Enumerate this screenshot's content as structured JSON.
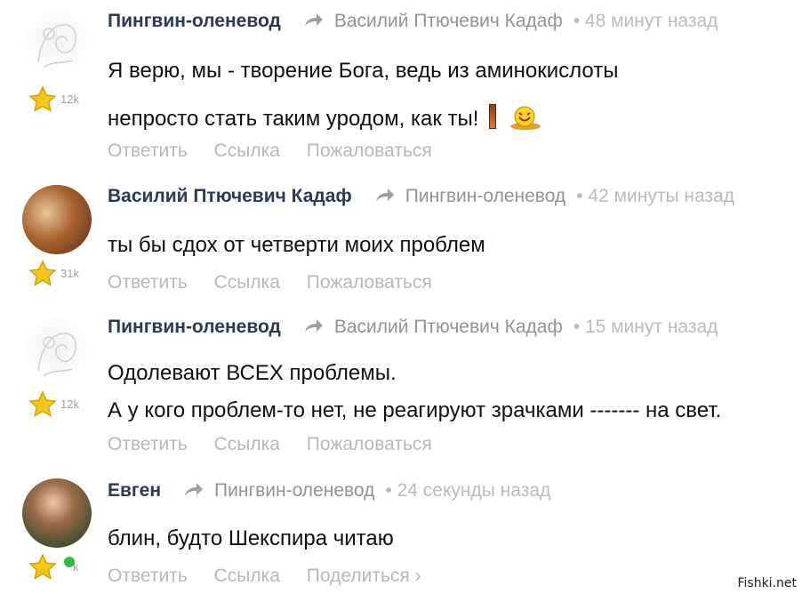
{
  "comments": [
    {
      "author": "Пингвин-оленевод",
      "reply_to": "Василий Птючевич Кадаф",
      "time": "• 48 минут назад",
      "rating": "12k",
      "lines": [
        "Я верю, мы - творение Бога, ведь из аминокислоты",
        "непросто стать таким уродом, как ты!"
      ],
      "actions": [
        "Ответить",
        "Ссылка",
        "Пожаловаться"
      ]
    },
    {
      "author": "Василий Птючевич Кадаф",
      "reply_to": "Пингвин-оленевод",
      "time": "• 42 минуты назад",
      "rating": "31k",
      "lines": [
        "ты бы сдох от четверти моих проблем"
      ],
      "actions": [
        "Ответить",
        "Ссылка",
        "Пожаловаться"
      ]
    },
    {
      "author": "Пингвин-оленевод",
      "reply_to": "Василий Птючевич Кадаф",
      "time": "• 15 минут назад",
      "rating": "12k",
      "lines": [
        "Одолевают ВСЕХ проблемы.",
        "А у кого проблем-то нет, не реагируют зрачками ------- на свет."
      ],
      "actions": [
        "Ответить",
        "Ссылка",
        "Пожаловаться"
      ]
    },
    {
      "author": "Евген",
      "reply_to": "Пингвин-оленевод",
      "time": "• 24 секунды назад",
      "rating": "k",
      "lines": [
        "блин, будто Шекспира читаю"
      ],
      "actions": [
        "Ответить",
        "Ссылка",
        "Поделиться ›"
      ]
    }
  ],
  "watermark": "Fishki.net",
  "colors": {
    "author": "#2b3a55",
    "muted": "#8f9399",
    "time": "#b7bbc0",
    "online": "#2ac13a"
  }
}
